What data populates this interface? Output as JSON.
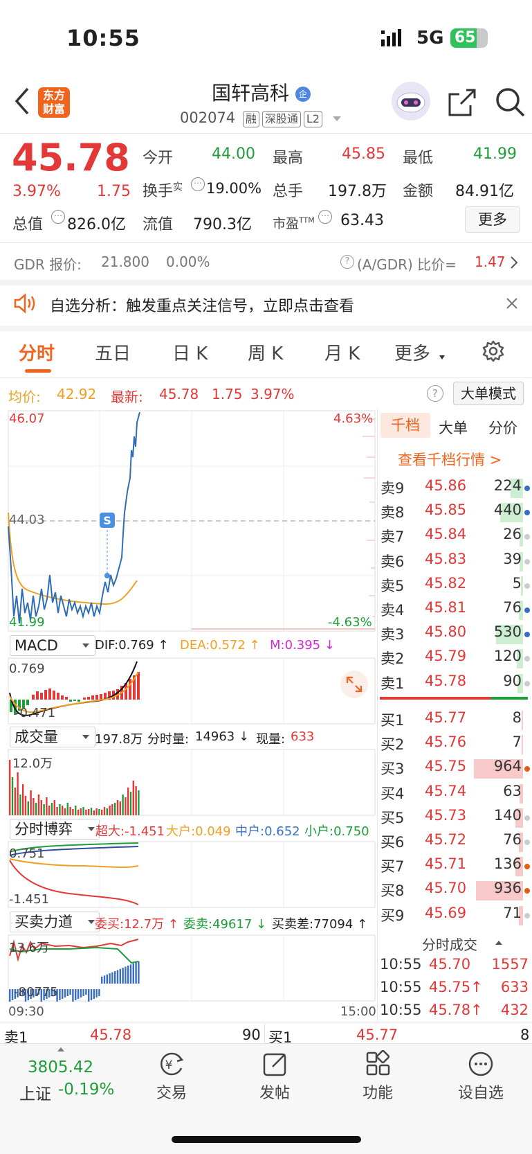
{
  "status": {
    "time": "10:55",
    "network": "5G",
    "battery": "65"
  },
  "header": {
    "back_label": "‹",
    "logo_line1": "东方",
    "logo_line2": "财富",
    "title": "国轩高科",
    "title_badge": "企",
    "code": "002074",
    "tags": [
      "融",
      "深股通",
      "L2"
    ]
  },
  "quote": {
    "price": "45.78",
    "change_pct": "3.97%",
    "change": "1.75",
    "open_label": "今开",
    "open": "44.00",
    "high_label": "最高",
    "high": "45.85",
    "low_label": "最低",
    "low": "41.99",
    "turnover_label": "换手",
    "turnover_sup": "实",
    "turnover": "19.00%",
    "volume_label": "总手",
    "volume": "197.8万",
    "amount_label": "金额",
    "amount": "84.91亿",
    "mktcap_label": "总值",
    "mktcap": "826.0亿",
    "float_label": "流值",
    "float": "790.3亿",
    "pe_label": "市盈",
    "pe_sup": "TTM",
    "pe": "63.43",
    "more_label": "更多"
  },
  "gdr": {
    "label": "GDR 报价:",
    "price": "21.800",
    "pct": "0.00%",
    "ratio_label": "(A/GDR) 比价=",
    "ratio": "1.47"
  },
  "notice": {
    "text": "自选分析：触发重点关注信号，立即点击查看"
  },
  "tabs": [
    "分时",
    "五日",
    "日 K",
    "周 K",
    "月 K",
    "更多"
  ],
  "avgline": {
    "avg_label": "均价:",
    "avg": "42.92",
    "last_label": "最新:",
    "last": "45.78",
    "chg": "1.75",
    "pct": "3.97%",
    "mode_label": "大单模式"
  },
  "chart": {
    "ymax": "46.07",
    "ymid": "44.03",
    "ymin": "41.99",
    "pct_max": "4.63%",
    "pct_min": "-4.63%",
    "time_start": "09:30",
    "time_end": "15:00",
    "signal_label": "S"
  },
  "macd": {
    "name": "MACD",
    "dif": "DIF:0.769 ↑",
    "dea": "DEA:0.572 ↑",
    "m": "M:0.395 ↓",
    "top": "0.769",
    "bottom": "-0.471"
  },
  "vol": {
    "name": "成交量",
    "total": "197.8万",
    "tick_label": "分时量:",
    "tick": "14963 ↓",
    "now_label": "现量:",
    "now": "633",
    "top": "12.0万"
  },
  "game": {
    "name": "分时博弈",
    "super": "超大:-1.451",
    "big": "大户:0.049",
    "mid": "中户:0.652",
    "small": "小户:0.750",
    "top": "0.751",
    "bottom": "-1.451"
  },
  "force": {
    "name": "买卖力道",
    "buy": "委买:12.7万 ↑",
    "sell": "委卖:49617 ↓",
    "diff": "买卖差:77094 ↑",
    "top": "13.6万",
    "bottom": "-80775"
  },
  "depth": {
    "tabs": [
      "千档",
      "大单",
      "分价"
    ],
    "link": "查看千档行情 >",
    "asks": [
      {
        "l": "卖9",
        "p": "45.86",
        "v": "224",
        "bar": 0.12,
        "dot": "#3a6fc0"
      },
      {
        "l": "卖8",
        "p": "45.85",
        "v": "440",
        "bar": 0.22,
        "dot": "#3a6fc0"
      },
      {
        "l": "卖7",
        "p": "45.84",
        "v": "26",
        "bar": 0.03,
        "dot": "#ccc"
      },
      {
        "l": "卖6",
        "p": "45.83",
        "v": "39",
        "bar": 0.03,
        "dot": "#ccc"
      },
      {
        "l": "卖5",
        "p": "45.82",
        "v": "5",
        "bar": 0.02,
        "dot": "#ccc"
      },
      {
        "l": "卖4",
        "p": "45.81",
        "v": "76",
        "bar": 0.04,
        "dot": "#3a6fc0"
      },
      {
        "l": "卖3",
        "p": "45.80",
        "v": "530",
        "bar": 0.26,
        "dot": "#3a6fc0"
      },
      {
        "l": "卖2",
        "p": "45.79",
        "v": "120",
        "bar": 0.06,
        "dot": "#ccc"
      },
      {
        "l": "卖1",
        "p": "45.78",
        "v": "90",
        "bar": 0.05,
        "dot": "#ccc"
      }
    ],
    "bids": [
      {
        "l": "买1",
        "p": "45.77",
        "v": "8",
        "bar": 0.01,
        "dot": "#fff"
      },
      {
        "l": "买2",
        "p": "45.76",
        "v": "7",
        "bar": 0.01,
        "dot": "#fff"
      },
      {
        "l": "买3",
        "p": "45.75",
        "v": "964",
        "bar": 0.47,
        "dot": "#e06010"
      },
      {
        "l": "买4",
        "p": "45.74",
        "v": "63",
        "bar": 0.03,
        "dot": "#fff"
      },
      {
        "l": "买5",
        "p": "45.73",
        "v": "140",
        "bar": 0.07,
        "dot": "#ccc"
      },
      {
        "l": "买6",
        "p": "45.72",
        "v": "76",
        "bar": 0.04,
        "dot": "#ccc"
      },
      {
        "l": "买7",
        "p": "45.71",
        "v": "136",
        "bar": 0.07,
        "dot": "#e06010"
      },
      {
        "l": "买8",
        "p": "45.70",
        "v": "936",
        "bar": 0.45,
        "dot": "#e06010"
      },
      {
        "l": "买9",
        "p": "45.69",
        "v": "71",
        "bar": 0.04,
        "dot": "#ccc"
      }
    ],
    "trades_title": "分时成交",
    "trades": [
      {
        "t": "10:55",
        "p": "45.70",
        "arrow": "",
        "v": "1557"
      },
      {
        "t": "10:55",
        "p": "45.75",
        "arrow": "↑",
        "v": "633"
      },
      {
        "t": "10:55",
        "p": "45.78",
        "arrow": "↑",
        "v": "432"
      }
    ]
  },
  "bottom_quote": {
    "sell_label": "卖1",
    "sell_price": "45.78",
    "sell_vol": "90",
    "buy_label": "买1",
    "buy_price": "45.77",
    "buy_vol": "8"
  },
  "index": {
    "value": "3805.42",
    "name": "上证",
    "pct": "-0.19%"
  },
  "nav": [
    "交易",
    "发帖",
    "功能",
    "设自选"
  ],
  "colors": {
    "up": "#e33838",
    "down": "#1e9e3a",
    "accent": "#f0641e",
    "price_line": "#2f6db5",
    "avg_line": "#f0a020"
  }
}
